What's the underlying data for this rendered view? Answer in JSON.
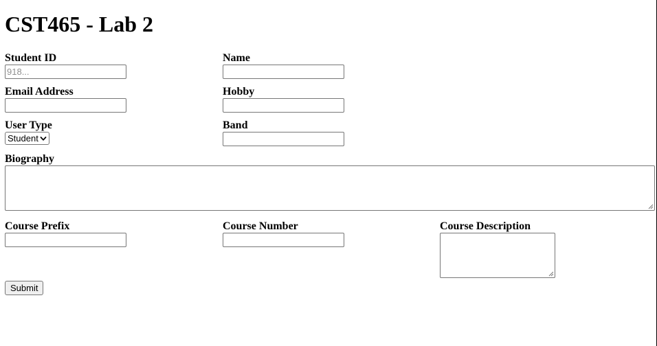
{
  "page": {
    "title": "CST465 - Lab 2"
  },
  "form": {
    "student_id": {
      "label": "Student ID",
      "value": "",
      "placeholder": "918..."
    },
    "name": {
      "label": "Name",
      "value": ""
    },
    "email": {
      "label": "Email Address",
      "value": ""
    },
    "hobby": {
      "label": "Hobby",
      "value": ""
    },
    "user_type": {
      "label": "User Type",
      "selected": "Student",
      "icon": "chevron-down-icon"
    },
    "band": {
      "label": "Band",
      "value": ""
    },
    "biography": {
      "label": "Biography",
      "value": ""
    },
    "course_prefix": {
      "label": "Course Prefix",
      "value": ""
    },
    "course_number": {
      "label": "Course Number",
      "value": ""
    },
    "course_description": {
      "label": "Course Description",
      "value": ""
    },
    "submit_label": "Submit"
  }
}
